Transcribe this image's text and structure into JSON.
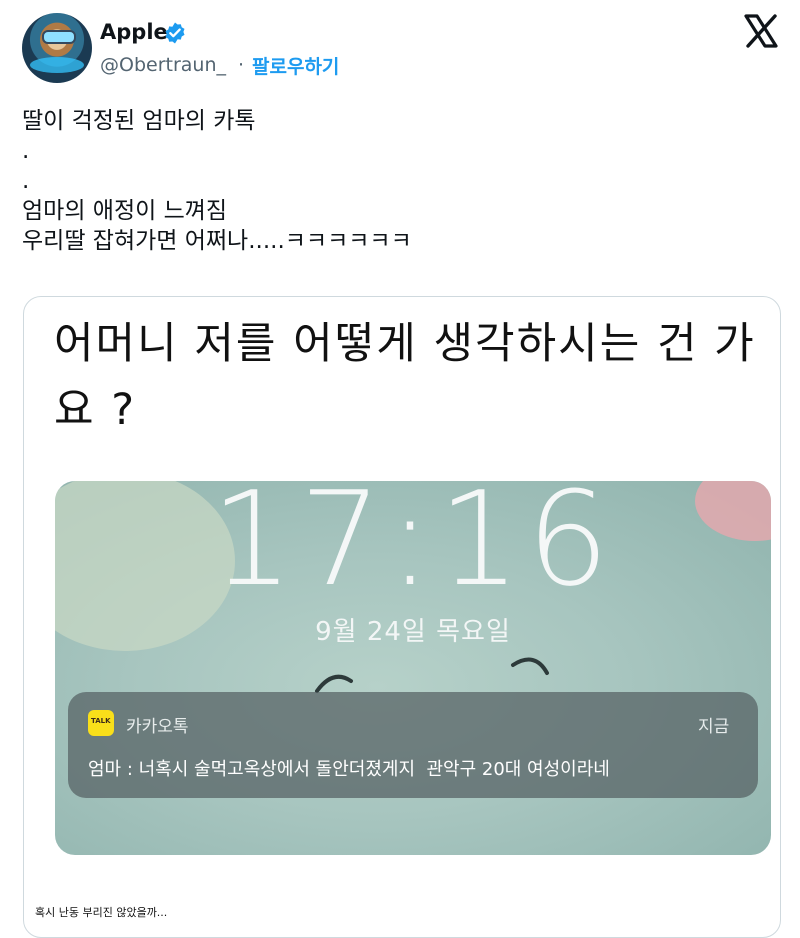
{
  "author": {
    "name": "Apple",
    "handle": "@Obertraun_",
    "separator": "·",
    "follow_label": "팔로우하기"
  },
  "tweet": {
    "lines": [
      "딸이 걱정된 엄마의 카톡",
      ".",
      ".",
      "엄마의 애정이 느껴짐",
      "우리딸 잡혀가면 어쩌나.....ㅋㅋㅋㅋㅋㅋ"
    ]
  },
  "card": {
    "headline": "어머니 저를 어떻게 생각하시는 건 가요 ?",
    "lockscreen": {
      "time": "17:16",
      "date": "9월 24일 목요일"
    },
    "notification": {
      "app_icon_text": "TALK",
      "app_name": "카카오톡",
      "time": "지금",
      "message": "엄마 : 너혹시 술먹고옥상에서 돌안더졌게지  관악구 20대 여성이라네"
    },
    "caption": "혹시 난동 부리진 않았을까..."
  },
  "colors": {
    "accent": "#1d9bf0",
    "kakao_yellow": "#f9df1a"
  },
  "icons": [
    "verified-badge-icon",
    "x-logo-icon",
    "kakaotalk-icon"
  ]
}
